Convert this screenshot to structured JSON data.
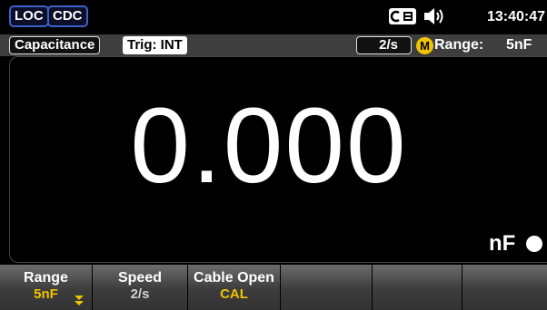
{
  "status": {
    "loc_tag": "LOC",
    "cdc_tag": "CDC",
    "time": "13:40:47"
  },
  "info": {
    "function": "Capacitance",
    "trigger": "Trig: INT",
    "rate": "2/s",
    "range_label": "Range:",
    "range_value": "5nF",
    "manual_indicator": "M"
  },
  "display": {
    "reading": "0.000",
    "unit": "nF"
  },
  "softkeys": [
    {
      "label": "Range",
      "value": "5nF"
    },
    {
      "label": "Speed",
      "value": "2/s"
    },
    {
      "label": "Cable Open",
      "value": "CAL"
    },
    {
      "label": "",
      "value": ""
    },
    {
      "label": "",
      "value": ""
    },
    {
      "label": "",
      "value": ""
    }
  ],
  "colors": {
    "accent_yellow": "#f0c400",
    "tag_border_blue": "#3a63c9",
    "info_bar_gray": "#3e3e3e"
  },
  "icons": [
    "remote-ce-icon",
    "speaker-icon",
    "manual-range-icon",
    "dropdown-arrow-icon"
  ]
}
